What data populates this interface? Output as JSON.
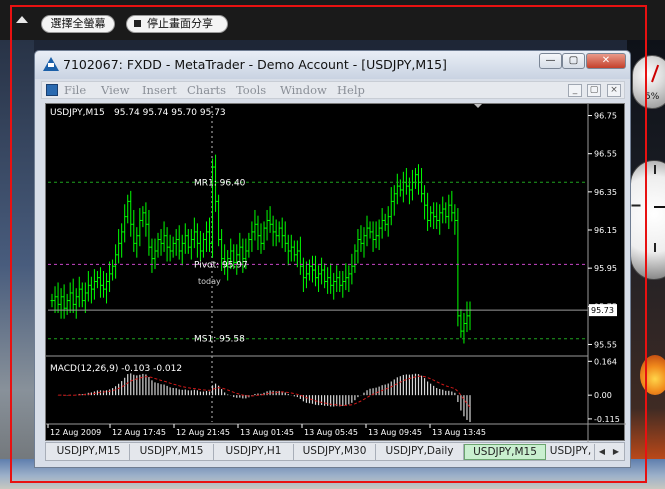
{
  "share_toolbar": {
    "select_fullscreen_label": "選擇全螢幕",
    "stop_sharing_label": "停止畫面分享"
  },
  "window": {
    "title": "7102067: FXDD - MetaTrader - Demo Account - [USDJPY,M15]",
    "minimize": "—",
    "maximize": "▢",
    "close": "✕"
  },
  "menu": {
    "items": [
      "File",
      "View",
      "Insert",
      "Charts",
      "Tools",
      "Window",
      "Help"
    ],
    "doc_minimize": "_",
    "doc_restore": "▢",
    "doc_close": "×"
  },
  "chart_data": [
    {
      "type": "bar",
      "subtype": "ohlc",
      "symbol_label": "USDJPY,M15",
      "ohlc_label": "95.74 95.74 95.70 95.73",
      "current_price_label": "95.73",
      "series_color": "#00ff00",
      "y_ticks": [
        "96.75",
        "96.55",
        "96.35",
        "96.15",
        "95.95",
        "95.75",
        "95.55"
      ],
      "ylim": [
        95.5,
        96.8
      ],
      "x_labels": [
        "12 Aug 2009",
        "12 Aug 17:45",
        "12 Aug 21:45",
        "13 Aug 01:45",
        "13 Aug 05:45",
        "13 Aug 09:45",
        "13 Aug 13:45"
      ],
      "levels": [
        {
          "label": "MR1: 96.40",
          "value": 96.4,
          "color": "#1fa31f"
        },
        {
          "label": "Pivot: 95.97",
          "value": 95.97,
          "color": "#c846c8"
        },
        {
          "label": "MS1: 95.58",
          "value": 95.58,
          "color": "#1fa31f"
        }
      ],
      "annotation": "today",
      "closes": [
        95.78,
        95.8,
        95.76,
        95.8,
        95.74,
        95.78,
        95.82,
        95.76,
        95.8,
        95.84,
        95.78,
        95.82,
        95.86,
        95.84,
        95.88,
        95.9,
        95.86,
        95.84,
        95.88,
        95.92,
        95.96,
        96.02,
        96.08,
        96.14,
        96.22,
        96.3,
        96.18,
        96.08,
        96.12,
        96.2,
        96.24,
        96.18,
        96.06,
        96.0,
        96.04,
        96.1,
        96.08,
        96.12,
        96.06,
        96.04,
        96.08,
        96.1,
        96.04,
        96.08,
        96.12,
        96.06,
        96.1,
        96.14,
        96.08,
        96.04,
        96.1,
        96.14,
        96.08,
        96.48,
        96.3,
        96.1,
        96.0,
        95.96,
        96.0,
        96.04,
        95.98,
        96.02,
        96.06,
        96.0,
        96.04,
        96.1,
        96.14,
        96.18,
        96.12,
        96.08,
        96.16,
        96.2,
        96.18,
        96.14,
        96.12,
        96.16,
        96.12,
        96.08,
        96.04,
        96.06,
        96.02,
        96.04,
        95.96,
        95.9,
        95.92,
        95.96,
        95.94,
        95.9,
        95.92,
        95.94,
        95.88,
        95.9,
        95.86,
        95.88,
        95.9,
        95.86,
        95.88,
        95.9,
        95.92,
        95.96,
        96.04,
        96.1,
        96.08,
        96.12,
        96.16,
        96.14,
        96.1,
        96.12,
        96.16,
        96.2,
        96.18,
        96.22,
        96.3,
        96.34,
        96.38,
        96.36,
        96.4,
        96.38,
        96.36,
        96.4,
        96.44,
        96.4,
        96.34,
        96.28,
        96.2,
        96.24,
        96.22,
        96.2,
        96.24,
        96.26,
        96.22,
        96.28,
        96.24,
        96.2,
        95.7,
        95.62,
        95.66,
        95.7,
        95.73
      ],
      "indicator": {
        "label": "MACD(12,26,9) -0.103 -0.012",
        "y_ticks": [
          "0.164",
          "0.00",
          "-0.115"
        ],
        "ylim": [
          -0.13,
          0.18
        ],
        "signal_color": "#d01818",
        "hist_color": "#d8d8d8"
      }
    }
  ],
  "tabs": [
    {
      "label": "USDJPY,M15",
      "active": false
    },
    {
      "label": "USDJPY,M15",
      "active": false
    },
    {
      "label": "USDJPY,H1",
      "active": false
    },
    {
      "label": "USDJPY,M30",
      "active": false
    },
    {
      "label": "USDJPY,Daily",
      "active": false
    },
    {
      "label": "USDJPY,M15",
      "active": true
    },
    {
      "label": "USDJPY,",
      "active": false
    }
  ],
  "tab_nav": {
    "prev": "◀",
    "next": "▶"
  },
  "gadgets": {
    "cpu_label": "5%"
  }
}
